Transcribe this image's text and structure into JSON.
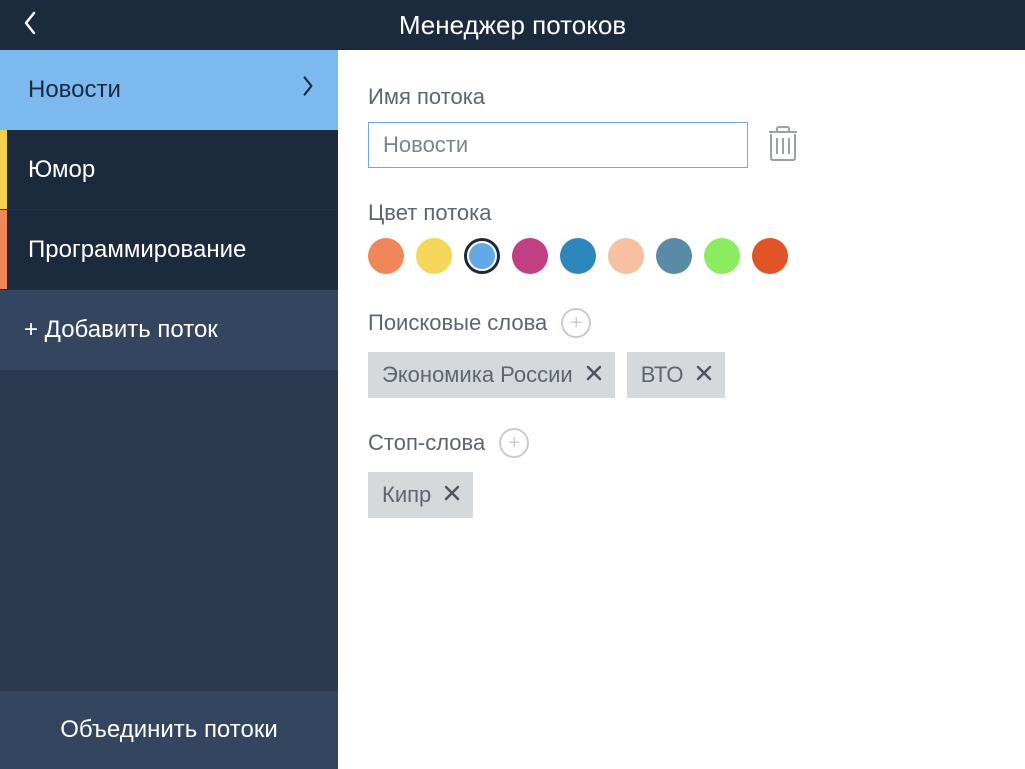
{
  "header": {
    "title": "Менеджер потоков"
  },
  "sidebar": {
    "streams": [
      {
        "label": "Новости",
        "selected": true,
        "color": null
      },
      {
        "label": "Юмор",
        "selected": false,
        "color": "#f1d04d"
      },
      {
        "label": "Программирование",
        "selected": false,
        "color": "#f0875a"
      }
    ],
    "add_label": "+ Добавить поток",
    "combine_label": "Объединить потоки"
  },
  "main": {
    "name_label": "Имя потока",
    "name_value": "Новости",
    "color_label": "Цвет потока",
    "colors": [
      {
        "hex": "#f0875a",
        "selected": false
      },
      {
        "hex": "#f4d65b",
        "selected": false
      },
      {
        "hex": "#63a9e6",
        "selected": true
      },
      {
        "hex": "#c03f85",
        "selected": false
      },
      {
        "hex": "#2d87bd",
        "selected": false
      },
      {
        "hex": "#f6c1a0",
        "selected": false
      },
      {
        "hex": "#5a8aa5",
        "selected": false
      },
      {
        "hex": "#8bec5f",
        "selected": false
      },
      {
        "hex": "#e05428",
        "selected": false
      }
    ],
    "search_words_label": "Поисковые слова",
    "search_words": [
      "Экономика России",
      "ВТО"
    ],
    "stop_words_label": "Стоп-слова",
    "stop_words": [
      "Кипр"
    ]
  }
}
